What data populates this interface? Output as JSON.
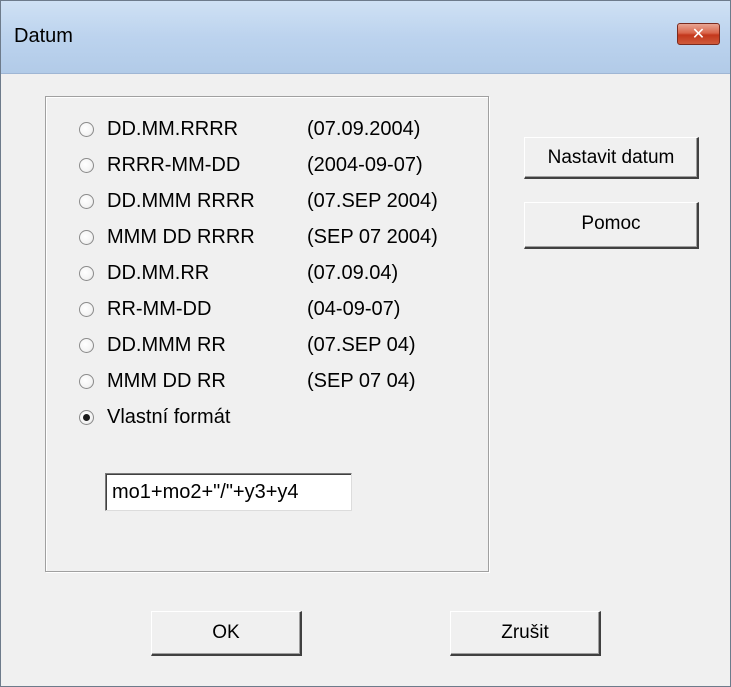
{
  "window": {
    "title": "Datum",
    "close_symbol": "✕",
    "close_icon": "close-icon"
  },
  "format_options": [
    {
      "label": "DD.MM.RRRR",
      "example": "(07.09.2004)",
      "checked": false
    },
    {
      "label": "RRRR-MM-DD",
      "example": "(2004-09-07)",
      "checked": false
    },
    {
      "label": "DD.MMM RRRR",
      "example": "(07.SEP 2004)",
      "checked": false
    },
    {
      "label": "MMM DD RRRR",
      "example": "(SEP 07 2004)",
      "checked": false
    },
    {
      "label": "DD.MM.RR",
      "example": "(07.09.04)",
      "checked": false
    },
    {
      "label": "RR-MM-DD",
      "example": "(04-09-07)",
      "checked": false
    },
    {
      "label": "DD.MMM RR",
      "example": "(07.SEP 04)",
      "checked": false
    },
    {
      "label": "MMM DD RR",
      "example": "(SEP 07 04)",
      "checked": false
    },
    {
      "label": "Vlastní formát",
      "example": "",
      "checked": true
    }
  ],
  "custom_format": {
    "value": "mo1+mo2+\"/\"+y3+y4"
  },
  "buttons": {
    "set_date": "Nastavit datum",
    "help": "Pomoc",
    "ok": "OK",
    "cancel": "Zrušit"
  }
}
